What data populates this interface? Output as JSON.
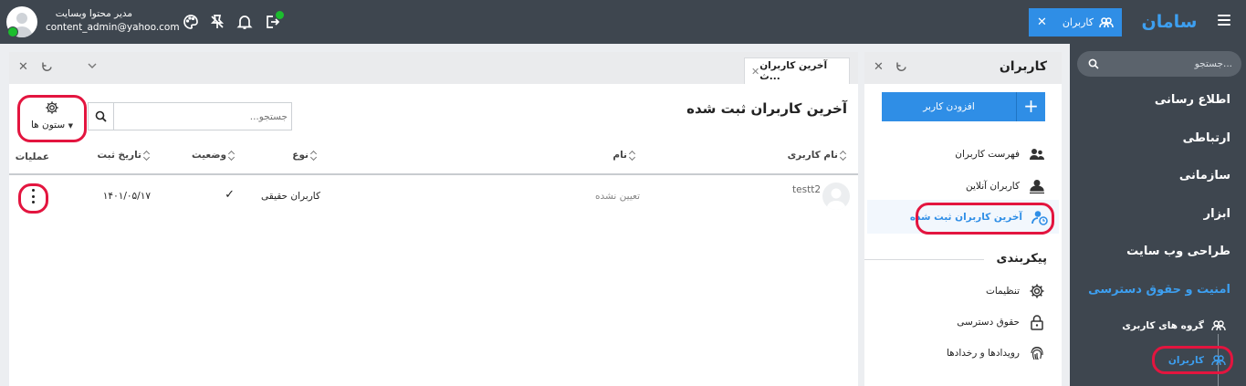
{
  "brand": "سامان",
  "top_tab": {
    "label": "کاربران"
  },
  "user": {
    "name": "مدیر محتوا وبسایت",
    "email": "content_admin@yahoo.com"
  },
  "sidebar": {
    "search_placeholder": "جستجو...",
    "items": [
      {
        "label": "اطلاع رسانی"
      },
      {
        "label": "ارتباطی"
      },
      {
        "label": "سازمانی"
      },
      {
        "label": "ابزار"
      },
      {
        "label": "طراحی وب سایت"
      },
      {
        "label": "امنیت و حقوق دسترسی"
      }
    ],
    "sub_items": [
      {
        "label": "گروه های کاربری"
      },
      {
        "label": "کاربران"
      }
    ]
  },
  "users_panel": {
    "title": "کاربران",
    "add_button": "افزودن کاربر",
    "menu": [
      {
        "label": "فهرست کاربران"
      },
      {
        "label": "کاربران آنلاین"
      },
      {
        "label": "آخرین کاربران ثبت شده"
      }
    ],
    "section_title": "پیکربندی",
    "config_menu": [
      {
        "label": "تنظیمات"
      },
      {
        "label": "حقوق دسترسی"
      },
      {
        "label": "رویدادها و رخدادها"
      }
    ]
  },
  "main": {
    "tab_label": "آخرین کاربران ث...",
    "title": "آخرین کاربران ثبت شده",
    "search_placeholder": "جستجو...",
    "columns_button": "ستون ها",
    "columns": {
      "username": "نام کاربری",
      "name": "نام",
      "type": "نوع",
      "status": "وضعیت",
      "date": "تاریخ ثبت",
      "actions": "عملیات"
    },
    "rows": [
      {
        "username": "testt2",
        "name": "تعیین نشده",
        "type": "کاربران حقیقی",
        "status": "✓",
        "date": "۱۴۰۱/۰۵/۱۷"
      }
    ]
  },
  "colors": {
    "topbar": "#3e464f",
    "accent": "#2f8ee6",
    "highlight": "#e3153f"
  }
}
